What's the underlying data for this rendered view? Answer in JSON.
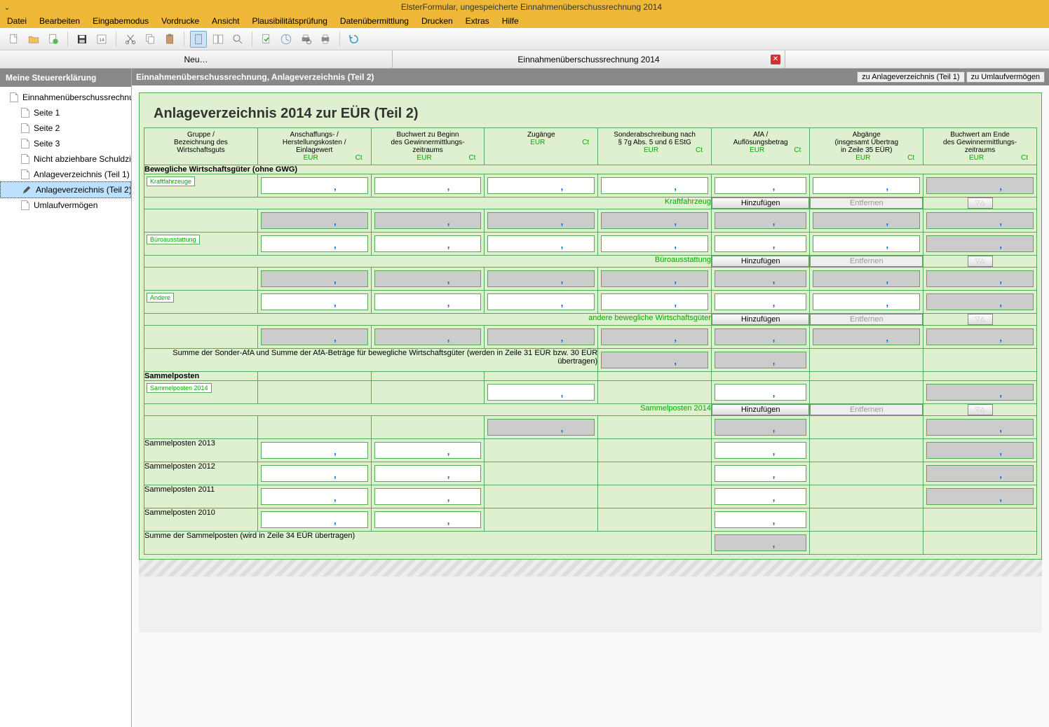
{
  "window": {
    "title": "ElsterFormular, ungespeicherte Einnahmenüberschussrechnung 2014"
  },
  "menu": [
    "Datei",
    "Bearbeiten",
    "Eingabemodus",
    "Vordrucke",
    "Ansicht",
    "Plausibilitätsprüfung",
    "Datenübermittlung",
    "Drucken",
    "Extras",
    "Hilfe"
  ],
  "tabs": [
    {
      "label": "Neu…",
      "closable": false
    },
    {
      "label": "Einnahmenüberschussrechnung 2014",
      "closable": true
    }
  ],
  "sidebar": {
    "header": "Meine Steuererklärung",
    "root": "Einnahmenüberschussrechnung",
    "items": [
      "Seite 1",
      "Seite 2",
      "Seite 3",
      "Nicht abziehbare Schuldzin…",
      "Anlageverzeichnis (Teil 1)",
      "Anlageverzeichnis (Teil 2)",
      "Umlaufvermögen"
    ],
    "selectedIndex": 5
  },
  "content": {
    "header": "Einnahmenüberschussrechnung, Anlageverzeichnis (Teil 2)",
    "nav_prev": "zu Anlageverzeichnis (Teil 1)",
    "nav_next": "zu Umlaufvermögen",
    "title": "Anlageverzeichnis 2014 zur EÜR (Teil 2)"
  },
  "cols": {
    "c1": "Gruppe /\nBezeichnung des\nWirtschaftsguts",
    "c2": "Anschaffungs- /\nHerstellungskosten /\nEinlagewert",
    "c3": "Buchwert zu Beginn\ndes Gewinnermittlungs-\nzeitraums",
    "c4": "Zugänge",
    "c5": "Sonderabschreibung nach\n§ 7g Abs. 5 und 6 EStG",
    "c6": "AfA /\nAuflösungsbetrag",
    "c7": "Abgänge\n(insgesamt Übertrag\nin Zeile 35 EÜR)",
    "c8": "Buchwert am Ende\ndes Gewinnermittlungs-\nzeitraums",
    "eur": "EUR",
    "ct": "Ct"
  },
  "sections": {
    "bwg_header": "Bewegliche Wirtschaftsgüter (ohne GWG)",
    "kfz_tag": "Kraftfahrzeuge",
    "kfz_label": "Kraftfahrzeug",
    "buero_tag": "Büroausstattung",
    "buero_label": "Büroausstattung",
    "andere_tag": "Andere",
    "andere_label": "andere bewegliche Wirtschaftsgüter",
    "sum_bwg": "Summe der Sonder-AfA und Summe der AfA-Beträge für bewegliche Wirtschaftsgüter (werden in Zeile 31 EÜR bzw. 30 EÜR übertragen)",
    "sammel_header": "Sammelposten",
    "sammel2014_tag": "Sammelposten 2014",
    "sammel2014_label": "Sammelposten 2014",
    "sp2013": "Sammelposten 2013",
    "sp2012": "Sammelposten 2012",
    "sp2011": "Sammelposten 2011",
    "sp2010": "Sammelposten 2010",
    "sum_sp": "Summe der Sammelposten (wird in Zeile 34 EÜR übertragen)",
    "btn_add": "Hinzufügen",
    "btn_del": "Entfernen",
    "btn_drop": "▽△"
  }
}
